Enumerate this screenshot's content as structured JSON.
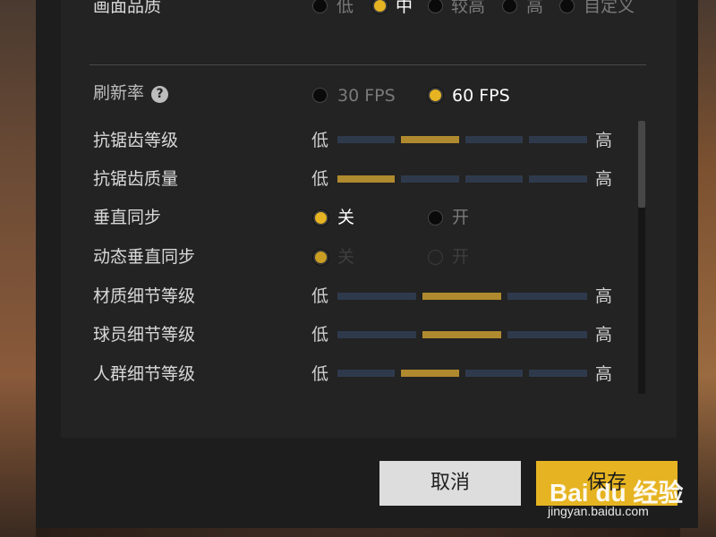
{
  "graphics_quality": {
    "label": "画面品质",
    "options": [
      "低",
      "中",
      "较高",
      "高",
      "自定义"
    ],
    "selected_index": 1
  },
  "refresh_rate": {
    "label": "刷新率",
    "help_glyph": "?",
    "options": [
      "30 FPS",
      "60 FPS"
    ],
    "selected": "60 FPS"
  },
  "scale": {
    "low": "低",
    "high": "高"
  },
  "antialias_level": {
    "label": "抗锯齿等级",
    "segments": 4,
    "selected_index": 1
  },
  "antialias_quality": {
    "label": "抗锯齿质量",
    "segments": 4,
    "selected_index": 0
  },
  "vsync": {
    "label": "垂直同步",
    "off": "关",
    "on": "开",
    "selected": "关"
  },
  "dynamic_vsync": {
    "label": "动态垂直同步",
    "off": "关",
    "on": "开",
    "selected": "关",
    "disabled": true
  },
  "material_detail": {
    "label": "材质细节等级",
    "segments": 3,
    "selected_index": 1
  },
  "player_detail": {
    "label": "球员细节等级",
    "segments": 3,
    "selected_index": 1
  },
  "crowd_detail": {
    "label": "人群细节等级",
    "segments": 4,
    "selected_index": 1
  },
  "buttons": {
    "cancel": "取消",
    "save": "保存"
  },
  "watermark": {
    "logo": "Bai du 经验",
    "url": "jingyan.baidu.com"
  },
  "colors": {
    "accent": "#e6b422",
    "segment": "#2e3a4c",
    "segment_selected": "#b08a2e"
  }
}
